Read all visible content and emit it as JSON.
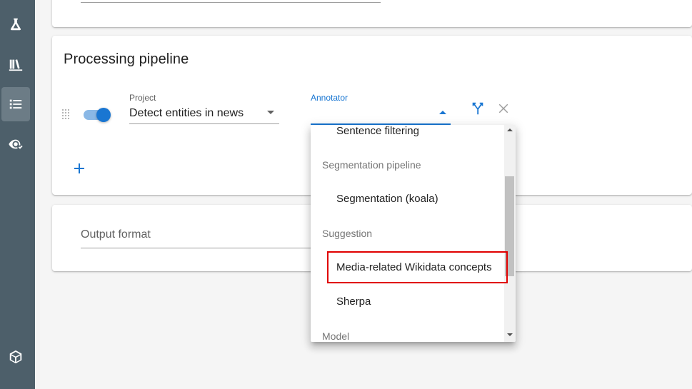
{
  "sidebar": {
    "icons": [
      "flask-icon",
      "library-icon",
      "list-icon",
      "eye-check-icon",
      "cube-icon"
    ],
    "active": "list-icon",
    "colors": {
      "background": "#4d5f6a",
      "active": "#6c7c86"
    }
  },
  "pipeline": {
    "title": "Processing pipeline",
    "step": {
      "enabled": true,
      "project_label": "Project",
      "project_value": "Detect entities in news",
      "annotator_label": "Annotator",
      "annotator_value": ""
    },
    "add_icon": "plus-icon"
  },
  "output": {
    "placeholder": "Output format"
  },
  "annotator_menu": {
    "items": [
      {
        "type": "option",
        "label": "Sentence filtering"
      },
      {
        "type": "group",
        "label": "Segmentation pipeline"
      },
      {
        "type": "option",
        "label": "Segmentation (koala)"
      },
      {
        "type": "group",
        "label": "Suggestion"
      },
      {
        "type": "option",
        "label": "Media-related Wikidata concepts",
        "highlighted": true
      },
      {
        "type": "option",
        "label": "Sherpa"
      },
      {
        "type": "group",
        "label": "Model"
      }
    ]
  },
  "colors": {
    "accent": "#1976d2",
    "highlight_box": "#e00000"
  }
}
